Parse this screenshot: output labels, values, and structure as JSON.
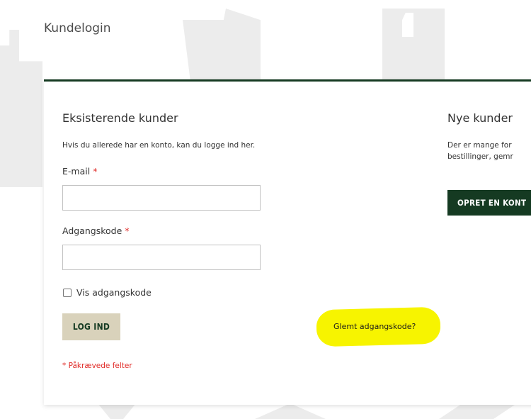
{
  "page": {
    "title": "Kundelogin"
  },
  "existing": {
    "title": "Eksisterende kunder",
    "description": "Hvis du allerede har en konto, kan du logge ind her.",
    "email_label": "E-mail",
    "email_value": "",
    "password_label": "Adgangskode",
    "password_value": "",
    "required_mark": "*",
    "show_password_label": "Vis adgangskode",
    "show_password_checked": false,
    "login_button": "LOG IND",
    "forgot_link": "Glemt adgangskode?",
    "required_note": "* Påkrævede felter"
  },
  "new_customers": {
    "title": "Nye kunder",
    "description_line1": "Der er mange for",
    "description_line2": "bestillinger, gemr",
    "create_button": "OPRET EN KONT"
  },
  "colors": {
    "brand_dark_green": "#153a22",
    "login_button_bg": "#d9d2bb",
    "required_red": "#e02b27",
    "highlight_yellow": "#f7f400"
  }
}
